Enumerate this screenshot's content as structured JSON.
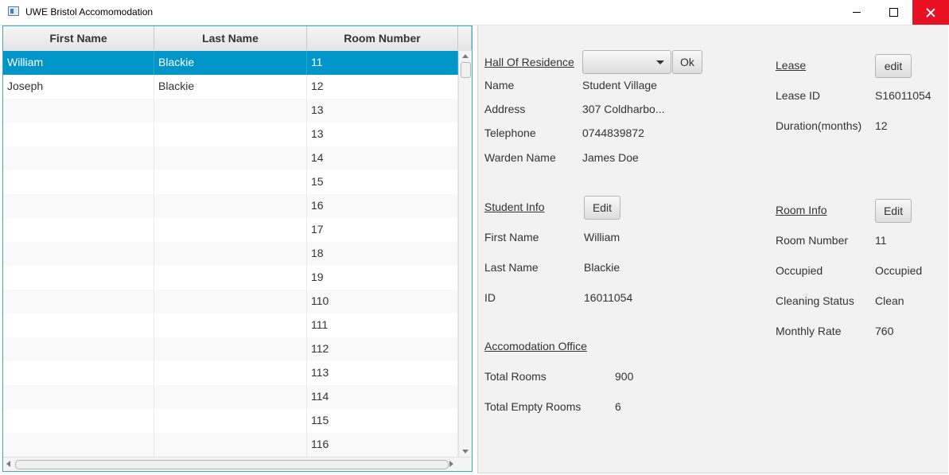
{
  "window": {
    "title": "UWE Bristol Accomomodation"
  },
  "table": {
    "columns": [
      "First Name",
      "Last Name",
      "Room Number"
    ],
    "rows": [
      [
        "William",
        "Blackie",
        "11"
      ],
      [
        "Joseph",
        "Blackie",
        "12"
      ],
      [
        "",
        "",
        "13"
      ],
      [
        "",
        "",
        "13"
      ],
      [
        "",
        "",
        "14"
      ],
      [
        "",
        "",
        "15"
      ],
      [
        "",
        "",
        "16"
      ],
      [
        "",
        "",
        "17"
      ],
      [
        "",
        "",
        "18"
      ],
      [
        "",
        "",
        "19"
      ],
      [
        "",
        "",
        "110"
      ],
      [
        "",
        "",
        "111"
      ],
      [
        "",
        "",
        "112"
      ],
      [
        "",
        "",
        "113"
      ],
      [
        "",
        "",
        "114"
      ],
      [
        "",
        "",
        "115"
      ],
      [
        "",
        "",
        "116"
      ]
    ],
    "selected_row": 0
  },
  "hall": {
    "heading": "Hall Of Residence",
    "ok_label": "Ok",
    "name_label": "Name",
    "name_value": "Student Village",
    "address_label": "Address",
    "address_value": "307 Coldharbo...",
    "telephone_label": "Telephone",
    "telephone_value": "0744839872",
    "warden_label": "Warden Name",
    "warden_value": "James Doe"
  },
  "lease": {
    "heading": "Lease",
    "edit_label": "edit",
    "id_label": "Lease ID",
    "id_value": "S16011054",
    "duration_label": "Duration(months)",
    "duration_value": "12"
  },
  "student": {
    "heading": "Student Info",
    "edit_label": "Edit",
    "first_label": "First Name",
    "first_value": "William",
    "last_label": "Last Name",
    "last_value": "Blackie",
    "id_label": "ID",
    "id_value": "16011054"
  },
  "room": {
    "heading": "Room Info",
    "edit_label": "Edit",
    "number_label": "Room Number",
    "number_value": "11",
    "occupied_label": "Occupied",
    "occupied_value": "Occupied",
    "cleaning_label": "Cleaning Status",
    "cleaning_value": "Clean",
    "rate_label": "Monthly Rate",
    "rate_value": "760"
  },
  "office": {
    "heading": "Accomodation Office",
    "total_label": "Total Rooms",
    "total_value": "900",
    "empty_label": "Total Empty Rooms",
    "empty_value": "6"
  },
  "colors": {
    "selection": "#0096c9",
    "close": "#e81123",
    "focus_border": "#3ea4d4"
  }
}
